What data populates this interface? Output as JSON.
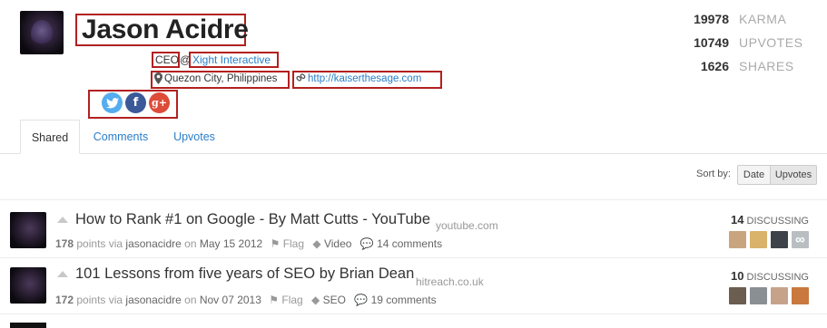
{
  "profile": {
    "name": "Jason Acidre",
    "role": "CEO",
    "at": "@",
    "company": "Xight Interactive",
    "location": "Quezon City, Philippines",
    "website": "http://kaiserthesage.com",
    "social": [
      "twitter-icon",
      "facebook-icon",
      "google-plus-icon"
    ]
  },
  "stats": [
    {
      "value": "19978",
      "label": "KARMA"
    },
    {
      "value": "10749",
      "label": "UPVOTES"
    },
    {
      "value": "1626",
      "label": "SHARES"
    }
  ],
  "tabs": [
    {
      "label": "Shared",
      "active": true
    },
    {
      "label": "Comments",
      "active": false
    },
    {
      "label": "Upvotes",
      "active": false
    }
  ],
  "sort": {
    "label": "Sort by:",
    "options": [
      {
        "label": "Date",
        "active": false
      },
      {
        "label": "Upvotes",
        "active": true
      }
    ]
  },
  "posts": [
    {
      "title": "How to Rank #1 on Google - By Matt Cutts - YouTube",
      "domain": "youtube.com",
      "points": "178",
      "points_text": "points via",
      "user": "jasonacidre",
      "on": "on",
      "date": "May 15 2012",
      "flag": "Flag",
      "tag": "Video",
      "comments": "14 comments",
      "discussing_count": "14",
      "discussing_label": "DISCUSSING"
    },
    {
      "title": "101 Lessons from five years of SEO by Brian Dean",
      "domain": "hitreach.co.uk",
      "points": "172",
      "points_text": "points via",
      "user": "jasonacidre",
      "on": "on",
      "date": "Nov 07 2013",
      "flag": "Flag",
      "tag": "SEO",
      "comments": "19 comments",
      "discussing_count": "10",
      "discussing_label": "DISCUSSING"
    }
  ],
  "colors": {
    "link": "#2a7ec8",
    "highlight_box": "#b32020",
    "twitter": "#55acee",
    "facebook": "#3b5998",
    "google_plus": "#dd4b39"
  }
}
